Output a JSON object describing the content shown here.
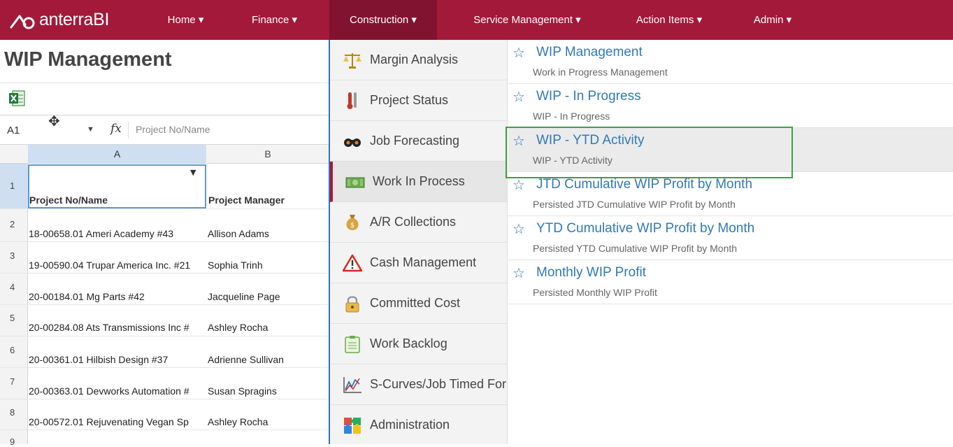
{
  "app": {
    "name": "anterraBI"
  },
  "nav": [
    {
      "label": "Home ▾"
    },
    {
      "label": "Finance ▾"
    },
    {
      "label": "Construction ▾"
    },
    {
      "label": "Service Management ▾"
    },
    {
      "label": "Action Items ▾"
    },
    {
      "label": "Admin ▾"
    }
  ],
  "page": {
    "title": "WIP Management"
  },
  "formula": {
    "cell_ref": "A1",
    "fx": "fx",
    "value": "Project No/Name"
  },
  "sheet": {
    "columns": [
      "A",
      "B"
    ],
    "row_numbers": [
      "1",
      "2",
      "3",
      "4",
      "5",
      "6",
      "7",
      "8",
      "9"
    ],
    "header": [
      "Project No/Name",
      "Project Manager"
    ],
    "rows": [
      [
        "18-00658.01 Ameri Academy #43",
        "Allison Adams"
      ],
      [
        "19-00590.04 Trupar America Inc. #21",
        "Sophia Trinh"
      ],
      [
        "20-00184.01 Mg Parts #42",
        "Jacqueline Page"
      ],
      [
        "20-00284.08 Ats Transmissions Inc #",
        "Ashley Rocha"
      ],
      [
        "20-00361.01 Hilbish Design #37",
        "Adrienne Sullivan"
      ],
      [
        "20-00363.01 Devworks Automation #",
        "Susan Spragins"
      ],
      [
        "20-00572.01 Rejuvenating Vegan Sp",
        "Ashley Rocha"
      ]
    ]
  },
  "menu": {
    "items": [
      {
        "label": "Margin Analysis",
        "icon": "scales-icon"
      },
      {
        "label": "Project Status",
        "icon": "thermometer-icon"
      },
      {
        "label": "Job Forecasting",
        "icon": "binoculars-icon"
      },
      {
        "label": "Work In Process",
        "icon": "money-icon"
      },
      {
        "label": "A/R Collections",
        "icon": "money-bag-icon"
      },
      {
        "label": "Cash Management",
        "icon": "warning-icon"
      },
      {
        "label": "Committed Cost",
        "icon": "lock-icon"
      },
      {
        "label": "Work Backlog",
        "icon": "clipboard-icon"
      },
      {
        "label": "S-Curves/Job Timed For",
        "icon": "line-chart-icon"
      },
      {
        "label": "Administration",
        "icon": "puzzle-icon"
      }
    ],
    "selected_index": 3,
    "subitems": [
      {
        "title": "WIP Management",
        "desc": "Work in Progress Management"
      },
      {
        "title": "WIP - In Progress",
        "desc": "WIP - In Progress"
      },
      {
        "title": "WIP - YTD Activity",
        "desc": "WIP - YTD Activity"
      },
      {
        "title": "JTD Cumulative WIP Profit by Month",
        "desc": "Persisted JTD Cumulative WIP Profit by Month"
      },
      {
        "title": "YTD Cumulative WIP Profit by Month",
        "desc": "Persisted YTD Cumulative WIP Profit by Month"
      },
      {
        "title": "Monthly WIP Profit",
        "desc": "Persisted Monthly WIP Profit"
      }
    ],
    "highlighted_index": 2
  },
  "colors": {
    "brand": "#a3193a",
    "brand_dark": "#821330",
    "link": "#3079b9",
    "highlight_box": "#3ba342"
  }
}
